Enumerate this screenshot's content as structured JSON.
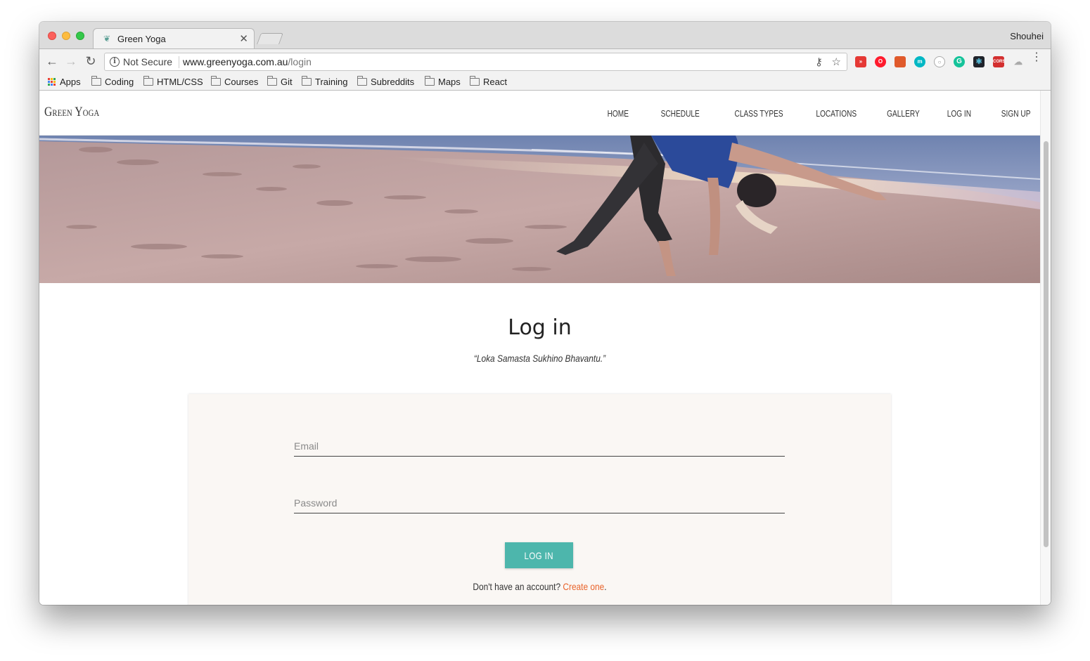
{
  "browser": {
    "tab_title": "Green Yoga",
    "profile_name": "Shouhei",
    "security_label": "Not Secure",
    "url_host": "www.greenyoga.com.au",
    "url_path": "/login",
    "bookmarks": [
      {
        "label": "Apps",
        "icon": "apps-grid-icon"
      },
      {
        "label": "Coding",
        "icon": "folder-icon"
      },
      {
        "label": "HTML/CSS",
        "icon": "folder-icon"
      },
      {
        "label": "Courses",
        "icon": "folder-icon"
      },
      {
        "label": "Git",
        "icon": "folder-icon"
      },
      {
        "label": "Training",
        "icon": "folder-icon"
      },
      {
        "label": "Subreddits",
        "icon": "folder-icon"
      },
      {
        "label": "Maps",
        "icon": "folder-icon"
      },
      {
        "label": "React",
        "icon": "folder-icon"
      }
    ],
    "extension_badges": {
      "cors": "CORS",
      "m": "m"
    }
  },
  "site": {
    "logo": "Green Yoga",
    "nav": [
      "HOME",
      "SCHEDULE",
      "CLASS TYPES",
      "LOCATIONS",
      "GALLERY",
      "LOG IN",
      "SIGN UP"
    ],
    "accent_color": "#4db6ac",
    "link_color": "#e9632a"
  },
  "login": {
    "title": "Log in",
    "quote": "“Loka Samasta Sukhino Bhavantu.”",
    "email_placeholder": "Email",
    "password_placeholder": "Password",
    "submit_label": "LOG IN",
    "signup_prompt": "Don't have an account?",
    "signup_link": "Create one",
    "signup_suffix": "."
  }
}
